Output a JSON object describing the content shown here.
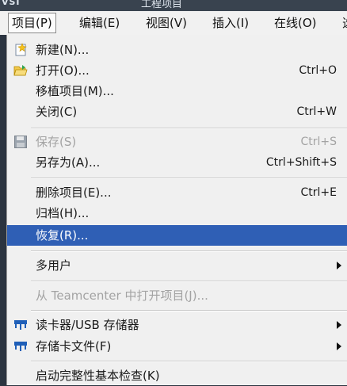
{
  "titlebar": {
    "logo": "VSI",
    "title": "工程项目"
  },
  "menubar": [
    {
      "label": "项目(P)",
      "active": true
    },
    {
      "label": "编辑(E)"
    },
    {
      "label": "视图(V)"
    },
    {
      "label": "插入(I)"
    },
    {
      "label": "在线(O)"
    },
    {
      "label": "选"
    }
  ],
  "menu": {
    "new": {
      "label": "新建(N)...",
      "icon": "new-sparkle-icon"
    },
    "open": {
      "label": "打开(O)...",
      "shortcut": "Ctrl+O",
      "icon": "folder-open-icon"
    },
    "migrate": {
      "label": "移植项目(M)..."
    },
    "close": {
      "label": "关闭(C)",
      "shortcut": "Ctrl+W"
    },
    "save": {
      "label": "保存(S)",
      "shortcut": "Ctrl+S",
      "icon": "floppy-disk-icon"
    },
    "save_as": {
      "label": "另存为(A)...",
      "shortcut": "Ctrl+Shift+S"
    },
    "delete": {
      "label": "删除项目(E)...",
      "shortcut": "Ctrl+E"
    },
    "archive": {
      "label": "归档(H)..."
    },
    "restore": {
      "label": "恢复(R)..."
    },
    "multiuser": {
      "label": "多用户"
    },
    "teamcenter": {
      "label": "从 Teamcenter 中打开项目(J)..."
    },
    "card_reader": {
      "label": "读卡器/USB 存储器",
      "icon": "card-reader-icon"
    },
    "memory_card": {
      "label": "存储卡文件(F)",
      "icon": "memory-card-icon"
    },
    "integrity": {
      "label": "启动完整性基本检查(K)"
    }
  },
  "colors": {
    "highlight": "#2f5fb5",
    "menu_bg": "#f0f0f0",
    "disabled_text": "#a3a3a3"
  }
}
